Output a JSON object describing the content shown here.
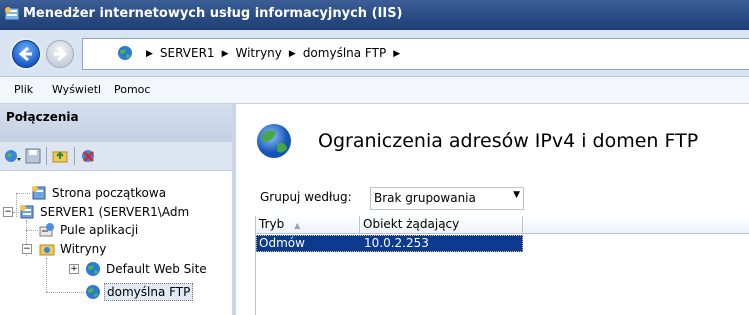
{
  "window": {
    "title": "Menedżer internetowych usług informacyjnych (IIS)"
  },
  "address": {
    "crumbs": [
      "SERVER1",
      "Witryny",
      "domyślna FTP"
    ]
  },
  "menu": {
    "items": [
      "Plik",
      "Wyświetl",
      "Pomoc"
    ]
  },
  "connections": {
    "title": "Połączenia",
    "tree": {
      "start": "Strona początkowa",
      "server": "SERVER1 (SERVER1\\Adm",
      "pools": "Pule aplikacji",
      "sites": "Witryny",
      "default_site": "Default Web Site",
      "ftp_site": "domyślna FTP"
    }
  },
  "main": {
    "heading": "Ograniczenia adresów IPv4 i domen FTP",
    "group_label": "Grupuj według:",
    "group_value": "Brak grupowania",
    "columns": [
      "Tryb",
      "Obiekt żądający"
    ],
    "rows": [
      {
        "mode": "Odmów",
        "requester": "10.0.2.253"
      }
    ]
  }
}
